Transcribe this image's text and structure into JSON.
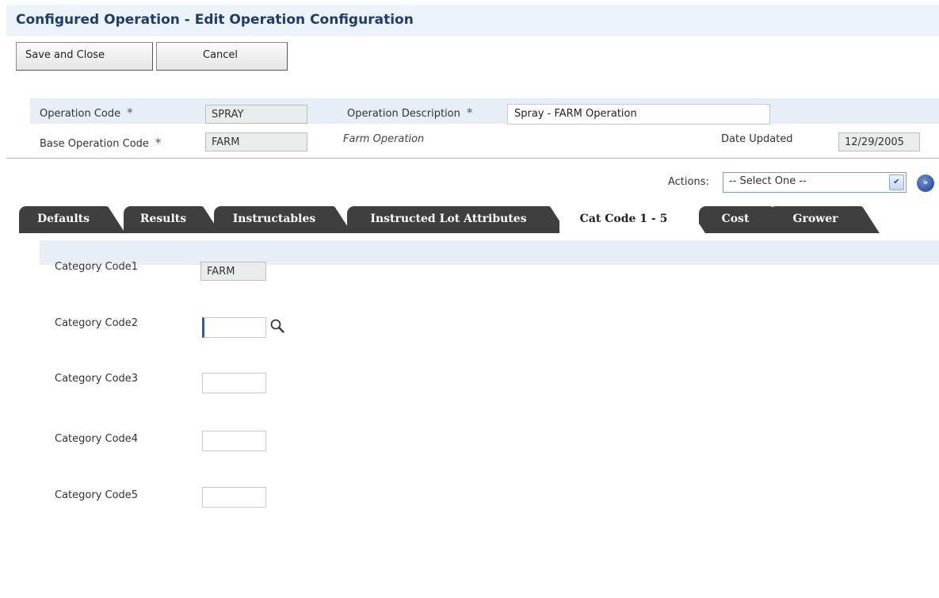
{
  "page": {
    "title": "Configured Operation - Edit Operation Configuration"
  },
  "toolbar": {
    "save_label": "Save and Close",
    "cancel_label": "Cancel"
  },
  "header": {
    "operation_code_label": "Operation Code",
    "operation_code_value": "SPRAY",
    "operation_description_label": "Operation Description",
    "operation_description_value": "Spray - FARM Operation",
    "base_operation_code_label": "Base Operation Code",
    "base_operation_code_value": "FARM",
    "base_operation_description": "Farm Operation",
    "date_updated_label": "Date Updated",
    "date_updated_value": "12/29/2005",
    "required_marker": "*"
  },
  "actions": {
    "label": "Actions:",
    "selected": "-- Select One --",
    "go_icon": "double-chevron-right-icon"
  },
  "tabs": [
    {
      "label": "Defaults",
      "active": false
    },
    {
      "label": "Results",
      "active": false
    },
    {
      "label": "Instructables",
      "active": false
    },
    {
      "label": "Instructed Lot Attributes",
      "active": false
    },
    {
      "label": "Cat Code 1 - 5",
      "active": true
    },
    {
      "label": "Cost",
      "active": false
    },
    {
      "label": "Grower",
      "active": false
    }
  ],
  "cat_codes": [
    {
      "label": "Category Code1",
      "value": "FARM"
    },
    {
      "label": "Category Code2",
      "value": ""
    },
    {
      "label": "Category Code3",
      "value": ""
    },
    {
      "label": "Category Code4",
      "value": ""
    },
    {
      "label": "Category Code5",
      "value": ""
    }
  ],
  "colors": {
    "title": "#1f3c6e",
    "tab_dark": "#3f3f3f",
    "band": "#e7eef6"
  }
}
